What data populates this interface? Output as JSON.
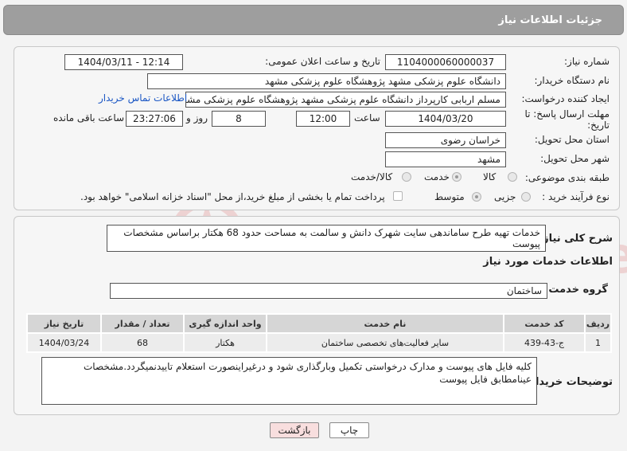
{
  "header": {
    "title": "جزئیات اطلاعات نیاز"
  },
  "fields": {
    "need_number_label": "شماره نیاز:",
    "need_number": "1104000060000037",
    "announce_label": "تاریخ و ساعت اعلان عمومی:",
    "announce_value": "1404/03/11 - 12:14",
    "buyer_org_label": "نام دستگاه خریدار:",
    "buyer_org": "دانشگاه علوم پزشکی مشهد   پژوهشگاه علوم پزشکی مشهد",
    "creator_label": "ایجاد کننده درخواست:",
    "creator": "مسلم اربابی کارپرداز دانشگاه علوم پزشکی مشهد   پژوهشگاه علوم پزشکی مشهد",
    "contact_link": "اطلاعات تماس خریدار",
    "deadline_label_1": "مهلت ارسال پاسخ: تا",
    "deadline_label_2": "تاریخ:",
    "deadline_date": "1404/03/20",
    "time_label": "ساعت",
    "deadline_time": "12:00",
    "days_value": "8",
    "days_label": "روز و",
    "remaining_time": "23:27:06",
    "remaining_label": "ساعت باقی مانده",
    "province_label": "استان محل تحویل:",
    "province": "خراسان رضوی",
    "city_label": "شهر محل تحویل:",
    "city": "مشهد",
    "category_label": "طبقه بندی موضوعی:",
    "category_options": [
      "کالا",
      "خدمت",
      "کالا/خدمت"
    ],
    "process_label": "نوع فرآیند خرید :",
    "process_options": [
      "جزیی",
      "متوسط"
    ],
    "payment_note": "پرداخت تمام یا بخشی از مبلغ خرید،از محل \"اسناد خزانه اسلامی\" خواهد بود."
  },
  "summary": {
    "label": "شرح کلی نیاز:",
    "text": "خدمات تهیه طرح ساماندهی سایت شهرک دانش و سالمت به مساحت حدود 68 هکتار براساس مشخصات پیوست"
  },
  "services": {
    "section_title": "اطلاعات خدمات مورد نیاز",
    "group_label": "گروه خدمت:",
    "group_value": "ساختمان",
    "table": {
      "headers": [
        "ردیف",
        "کد خدمت",
        "نام خدمت",
        "واحد اندازه گیری",
        "تعداد / مقدار",
        "تاریخ نیاز"
      ],
      "rows": [
        [
          "1",
          "ج-43-439",
          "سایر فعالیت‌های تخصصی ساختمان",
          "هکتار",
          "68",
          "1404/03/24"
        ]
      ]
    }
  },
  "notes": {
    "label": "توضیحات خریدار:",
    "text": "کلیه فایل های پیوست و مدارک درخواستی تکمیل وبارگذاری شود و درغیراینصورت استعلام تاییدنمیگردد.مشخصات عینامطابق فایل پیوست"
  },
  "buttons": {
    "print": "چاپ",
    "back": "بازگشت"
  },
  "watermark": {
    "text": "AriaTender.neT"
  },
  "colors": {
    "header_bg": "#9e9e9e",
    "link": "#1a56c4",
    "back_button_bg": "#f8dede"
  }
}
